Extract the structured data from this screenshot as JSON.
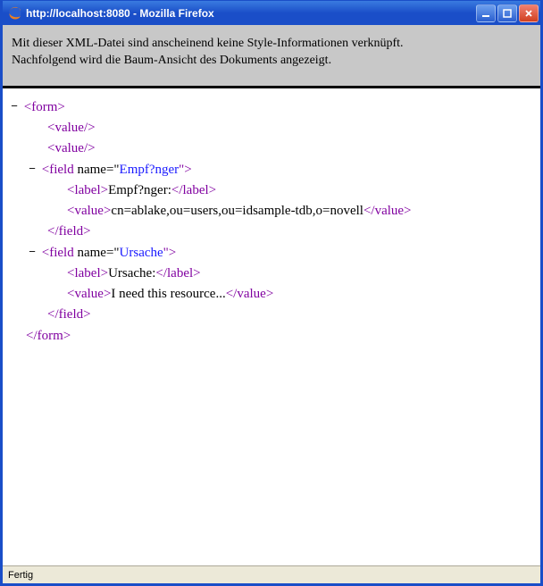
{
  "window": {
    "title": "http://localhost:8080 - Mozilla Firefox"
  },
  "notice": {
    "line1": "Mit dieser XML-Datei sind anscheinend keine Style-Informationen verknüpft.",
    "line2": "Nachfolgend wird die Baum-Ansicht des Dokuments angezeigt."
  },
  "xml": {
    "toggle": "−",
    "form_open": "<form>",
    "form_close": "</form>",
    "value_self1": "<value/>",
    "value_self2": "<value/>",
    "field1": {
      "open_prefix": "<field ",
      "attr_name": "name",
      "eq": "=\"",
      "attr_value": "Empf?nger",
      "open_suffix": "\">",
      "label_open": "<label>",
      "label_text": "Empf?nger:",
      "label_close": "</label>",
      "value_open": "<value>",
      "value_text": "cn=ablake,ou=users,ou=idsample-tdb,o=novell",
      "value_close": "</value>",
      "close": "</field>"
    },
    "field2": {
      "open_prefix": "<field ",
      "attr_name": "name",
      "eq": "=\"",
      "attr_value": "Ursache",
      "open_suffix": "\">",
      "label_open": "<label>",
      "label_text": "Ursache:",
      "label_close": "</label>",
      "value_open": "<value>",
      "value_text": "I need this resource...",
      "value_close": "</value>",
      "close": "</field>"
    }
  },
  "status": {
    "text": "Fertig"
  }
}
